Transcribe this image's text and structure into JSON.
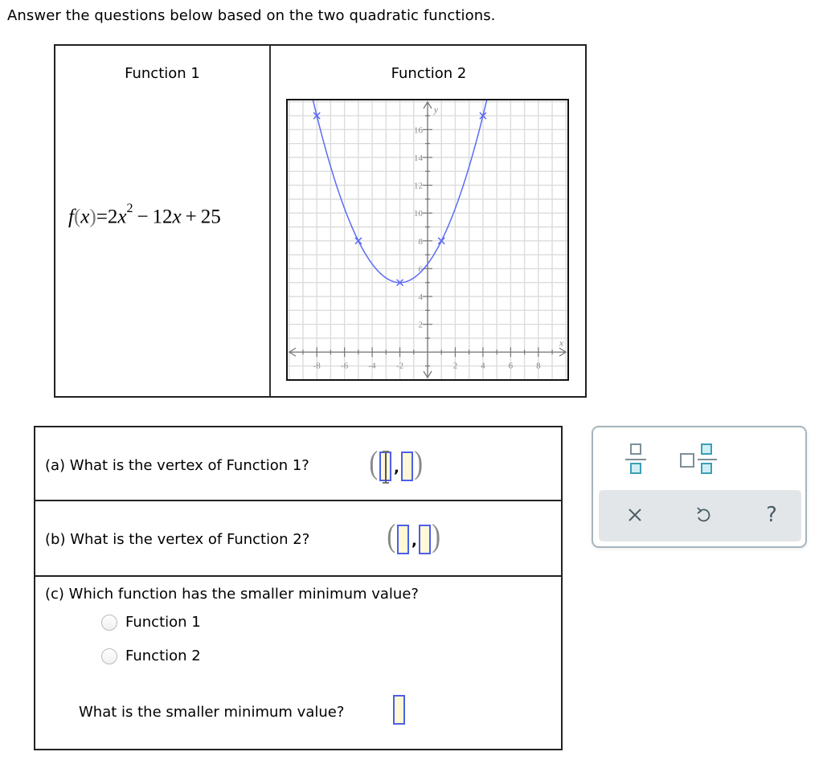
{
  "instructions": "Answer the questions below based on the two quadratic functions.",
  "functions_table": {
    "function1": {
      "header": "Function 1",
      "formula_parts": {
        "f": "f",
        "open": "(",
        "x": "x",
        "close": ")",
        "eq": "=2",
        "x2": "x",
        "exp": "2",
        "rest": " − 12",
        "x3": "x",
        "tail": " + 25"
      }
    },
    "function2": {
      "header": "Function 2"
    }
  },
  "chart_data": {
    "type": "line",
    "title": "Function 2",
    "xlabel": "x",
    "ylabel": "y",
    "xlim": [
      -10.1,
      10.1
    ],
    "ylim": [
      -1.95,
      18.1
    ],
    "grid": true,
    "x_ticks": [
      -8,
      -6,
      -4,
      -2,
      2,
      4,
      6,
      8
    ],
    "y_ticks": [
      2,
      4,
      6,
      8,
      10,
      12,
      14,
      16
    ],
    "series": [
      {
        "name": "Function 2",
        "color": "#5b6cf2",
        "equation": "y = (x + 2)^2 / 3 + 5",
        "marked_points": [
          {
            "x": -8,
            "y": 17
          },
          {
            "x": -5,
            "y": 8
          },
          {
            "x": -2,
            "y": 5
          },
          {
            "x": 1,
            "y": 8
          },
          {
            "x": 4,
            "y": 17
          }
        ],
        "vertex": {
          "x": -2,
          "y": 5
        }
      }
    ]
  },
  "questions": {
    "a": {
      "text": "(a) What is the vertex of Function 1?",
      "x_value": "",
      "y_value": "",
      "comma": ","
    },
    "b": {
      "text": "(b) What is the vertex of Function 2?",
      "x_value": "",
      "y_value": "",
      "comma": ","
    },
    "c": {
      "text": "(c) Which function has the smaller minimum value?",
      "options": [
        {
          "label": "Function 1",
          "selected": false
        },
        {
          "label": "Function 2",
          "selected": false
        }
      ],
      "followup": "What is the smaller minimum value?",
      "followup_value": ""
    }
  },
  "toolbar": {
    "buttons": [
      {
        "name": "fraction",
        "icon": "fraction-icon"
      },
      {
        "name": "mixed-number",
        "icon": "mixed-number-icon"
      }
    ],
    "actions": [
      {
        "name": "clear",
        "glyph": "✕"
      },
      {
        "name": "undo",
        "glyph": "↺"
      },
      {
        "name": "help",
        "glyph": "?"
      }
    ]
  },
  "colors": {
    "curve": "#5b6cf2",
    "answer_box_border": "#4c5fe8",
    "answer_box_fill": "#fff8d6",
    "toolbar_accent": "#3b9fb5"
  }
}
